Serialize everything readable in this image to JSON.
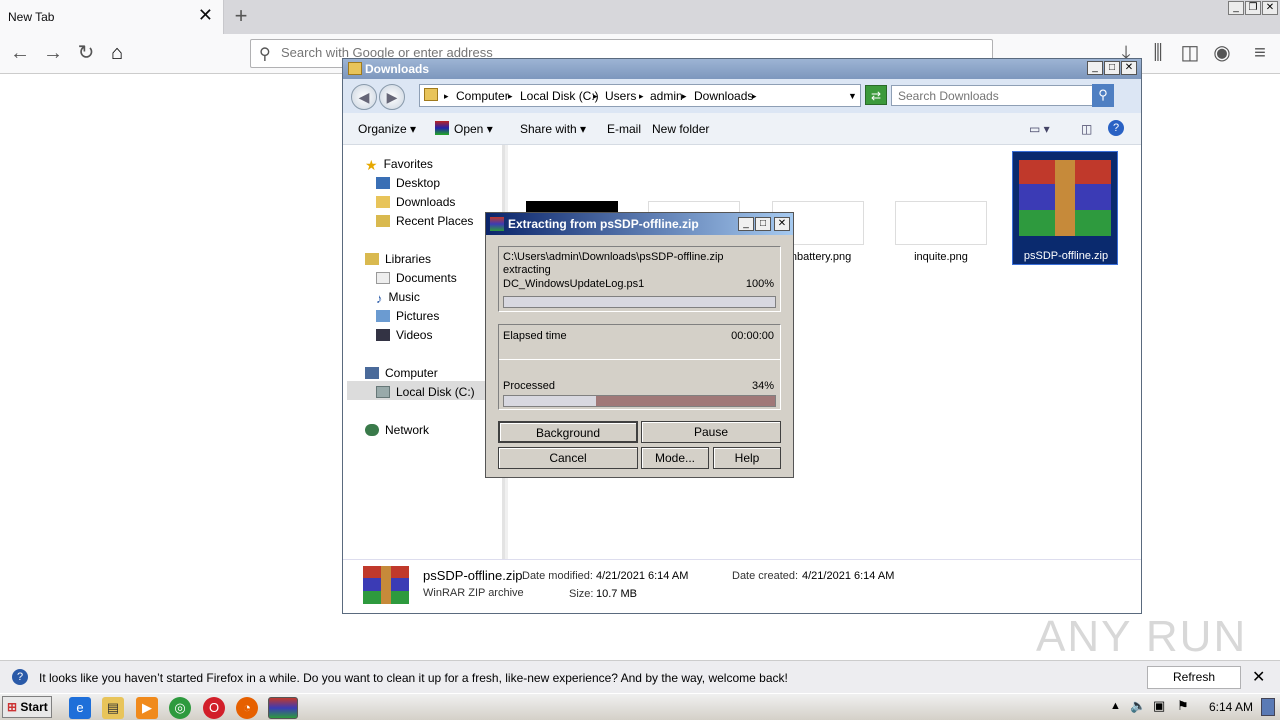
{
  "browser": {
    "tab_title": "New Tab",
    "url_placeholder": "Search with Google or enter address"
  },
  "explorer": {
    "title": "Downloads",
    "breadcrumb": [
      "Computer",
      "Local Disk (C:)",
      "Users",
      "admin",
      "Downloads"
    ],
    "search_placeholder": "Search Downloads",
    "commands": {
      "organize": "Organize",
      "open": "Open",
      "share_with": "Share with",
      "email": "E-mail",
      "new_folder": "New folder"
    },
    "nav": {
      "favorites": "Favorites",
      "desktop": "Desktop",
      "downloads": "Downloads",
      "recent_places": "Recent Places",
      "libraries": "Libraries",
      "documents": "Documents",
      "music": "Music",
      "pictures": "Pictures",
      "videos": "Videos",
      "computer": "Computer",
      "local_disk": "Local Disk (C:)",
      "network": "Network"
    },
    "files": [
      {
        "name": "enbattery.png"
      },
      {
        "name": "inquite.png"
      },
      {
        "name": "psSDP-offline.zip"
      }
    ],
    "details": {
      "filename": "psSDP-offline.zip",
      "type": "WinRAR ZIP archive",
      "date_modified_label": "Date modified:",
      "date_modified": "4/21/2021 6:14 AM",
      "date_created_label": "Date created:",
      "date_created": "4/21/2021 6:14 AM",
      "size_label": "Size:",
      "size": "10.7 MB"
    }
  },
  "rar_dialog": {
    "title": "Extracting from psSDP-offline.zip",
    "path": "C:\\Users\\admin\\Downloads\\psSDP-offline.zip",
    "action": "extracting",
    "current_file": "DC_WindowsUpdateLog.ps1",
    "file_percent_text": "100%",
    "file_progress": 1.0,
    "elapsed_label": "Elapsed time",
    "elapsed_value": "00:00:00",
    "processed_label": "Processed",
    "processed_percent_text": "34%",
    "processed_progress": 0.34,
    "buttons": {
      "background": "Background",
      "pause": "Pause",
      "cancel": "Cancel",
      "mode": "Mode...",
      "help": "Help"
    }
  },
  "notification": {
    "text": "It looks like you haven’t started Firefox in a while. Do you want to clean it up for a fresh, like-new experience? And by the way, welcome back!",
    "button": "Refresh Firefox…"
  },
  "taskbar": {
    "start": "Start",
    "clock": "6:14 AM"
  },
  "watermark": "ANY RUN"
}
